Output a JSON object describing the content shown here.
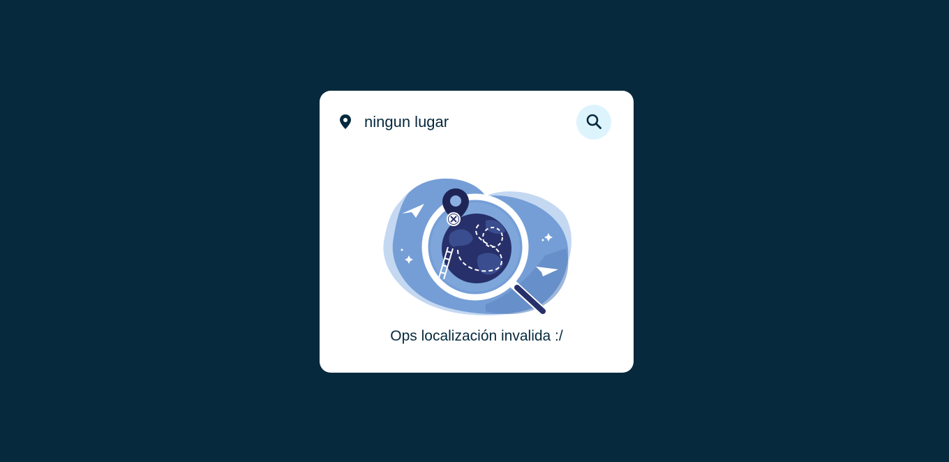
{
  "search": {
    "value": "ningun lugar",
    "location_icon": "map-pin-icon",
    "button_icon": "search-icon"
  },
  "illustration": {
    "name": "location-not-found-illustration"
  },
  "message": {
    "text": "Ops localización invalida :/"
  },
  "colors": {
    "background": "#06293d",
    "card": "#ffffff",
    "search_button_bg": "#ddf4fd",
    "text": "#06293d",
    "illustration_blue": "#759ed6",
    "illustration_dark": "#27306a"
  }
}
